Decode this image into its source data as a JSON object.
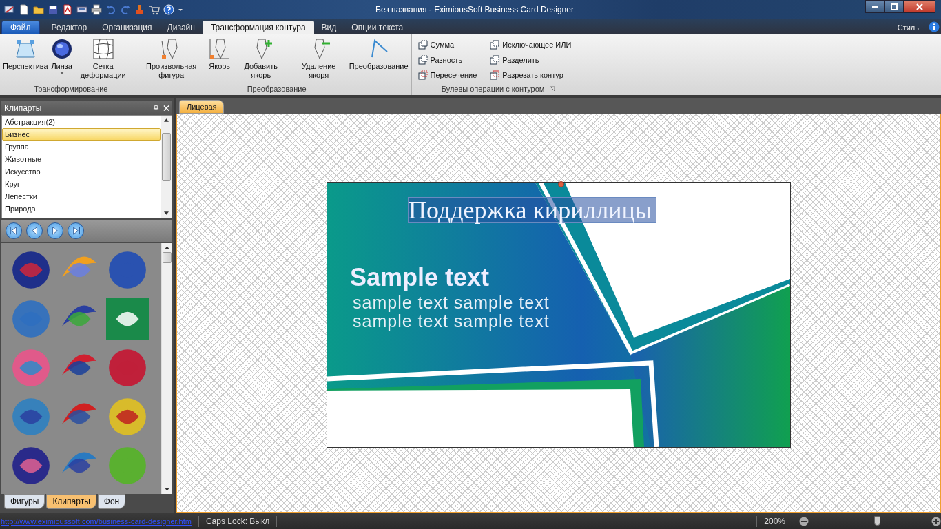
{
  "window": {
    "title": "Без названия - EximiousSoft Business Card Designer"
  },
  "file_menu": "Файл",
  "tabs": [
    {
      "label": "Редактор",
      "selected": false
    },
    {
      "label": "Организация",
      "selected": false
    },
    {
      "label": "Дизайн",
      "selected": false
    },
    {
      "label": "Трансформация контура",
      "selected": true
    },
    {
      "label": "Вид",
      "selected": false
    },
    {
      "label": "Опции текста",
      "selected": false
    }
  ],
  "style_menu": "Стиль",
  "ribbon_groups": [
    {
      "kind": "large",
      "label": "Трансформирование",
      "buttons": [
        {
          "label": "Перспектива"
        },
        {
          "label": "Линза",
          "dropdown": true
        },
        {
          "label": "Сетка деформации"
        }
      ]
    },
    {
      "kind": "large",
      "label": "Преобразование",
      "buttons": [
        {
          "label": "Произвольная фигура"
        },
        {
          "label": "Якорь"
        },
        {
          "label": "Добавить якорь"
        },
        {
          "label": "Удаление якоря"
        },
        {
          "label": "Преобразование"
        }
      ]
    },
    {
      "kind": "small",
      "label": "Булевы операции с контуром",
      "buttons": [
        {
          "label": "Сумма"
        },
        {
          "label": "Разность"
        },
        {
          "label": "Пересечение"
        },
        {
          "label": "Исключающее ИЛИ"
        },
        {
          "label": "Разделить"
        },
        {
          "label": "Разрезать контур"
        }
      ]
    }
  ],
  "panel": {
    "title": "Клипарты",
    "categories": [
      {
        "label": "Абстракция(2)",
        "selected": false
      },
      {
        "label": "Бизнес",
        "selected": true
      },
      {
        "label": "Группа",
        "selected": false
      },
      {
        "label": "Животные",
        "selected": false
      },
      {
        "label": "Искусство",
        "selected": false
      },
      {
        "label": "Круг",
        "selected": false
      },
      {
        "label": "Лепестки",
        "selected": false
      },
      {
        "label": "Природа",
        "selected": false
      }
    ],
    "bottom_tabs": [
      {
        "label": "Фигуры",
        "selected": false
      },
      {
        "label": "Клипарты",
        "selected": true
      },
      {
        "label": "Фон",
        "selected": false
      }
    ]
  },
  "document_tabs": [
    {
      "label": "Лицевая",
      "selected": true
    }
  ],
  "card": {
    "selected_text": "Поддержка кириллицы",
    "title": "Sample text",
    "lines": [
      "sample text sample text",
      "sample text sample text"
    ]
  },
  "status_bar": {
    "link": "http://www.eximioussoft.com/business-card-designer.htm",
    "caps_lock": "Caps Lock: Выкл",
    "zoom": "200%",
    "zoom_slider": {
      "level": 0.55
    }
  }
}
